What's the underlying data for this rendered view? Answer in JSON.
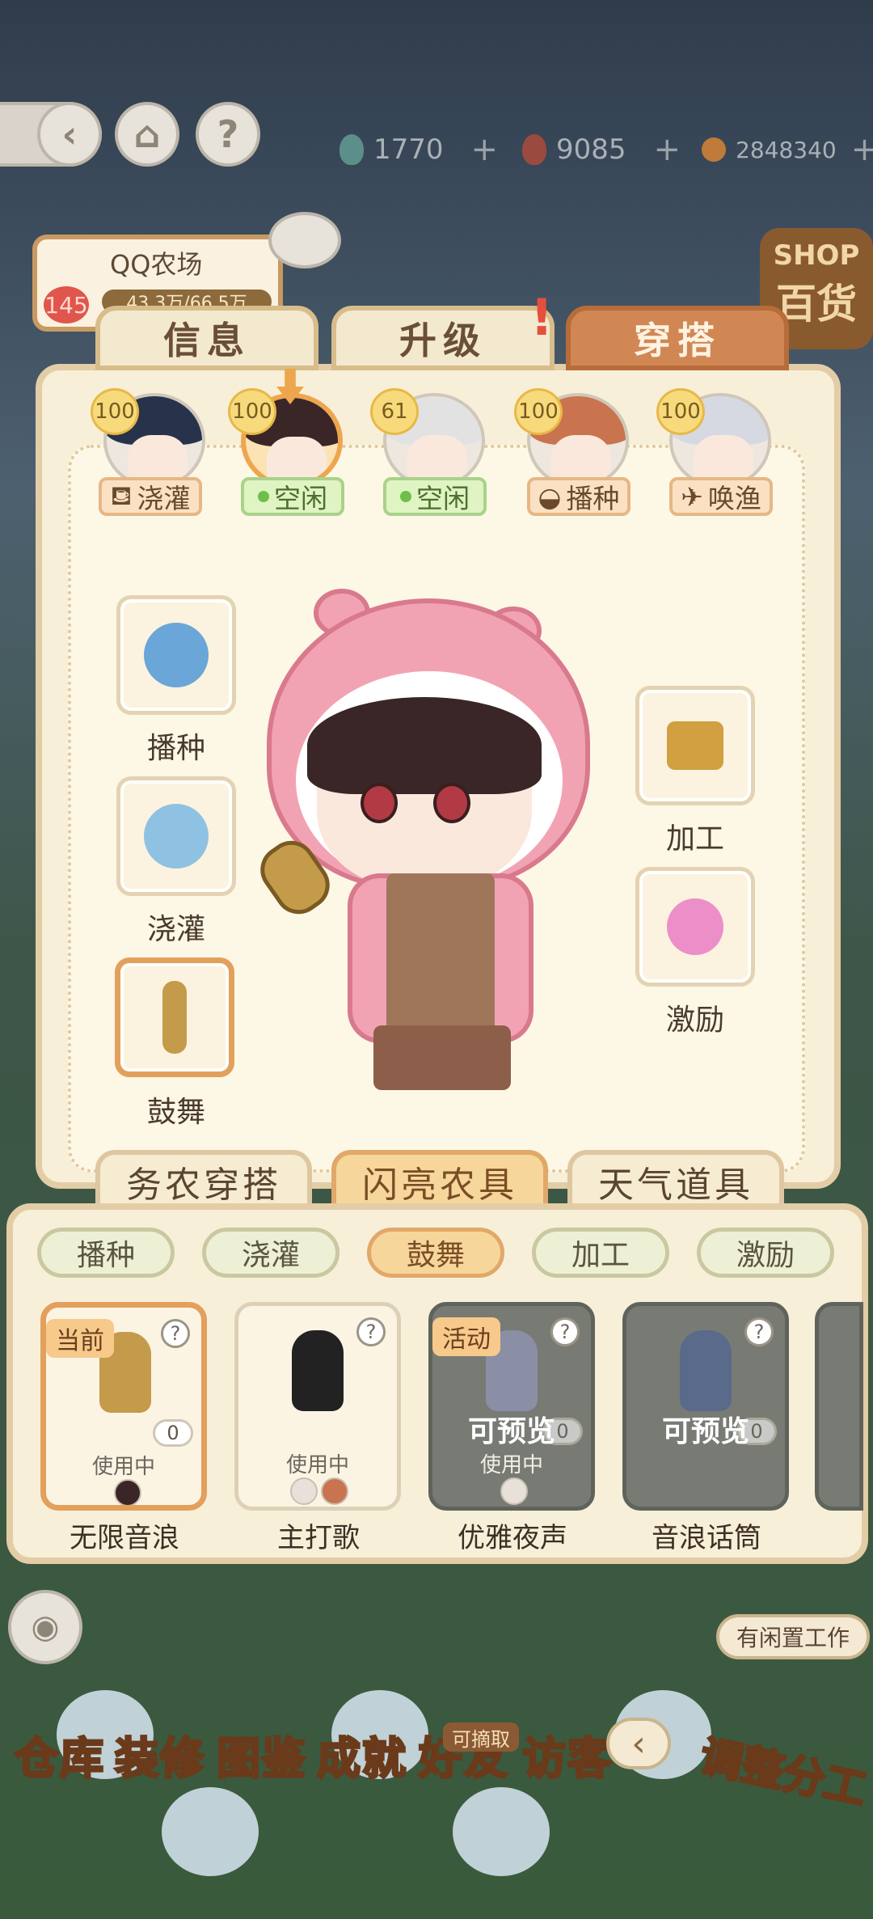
{
  "colors": {
    "accent": "#d18754",
    "panel": "#f8efd9",
    "idle": "#6cc04a",
    "current": "#e2a05c"
  },
  "top_icons": [
    "back-icon",
    "home-icon",
    "help-icon"
  ],
  "resources": [
    {
      "icon": "leaf-icon",
      "value": "1770",
      "plus": "+"
    },
    {
      "icon": "feather-icon",
      "value": "9085",
      "plus": "+"
    },
    {
      "icon": "coin-icon",
      "value": "2848340",
      "plus": "+"
    }
  ],
  "farm": {
    "name": "QQ农场",
    "level": "145",
    "progress": "43.3万/66.5万"
  },
  "shop": {
    "line1": "SHOP",
    "line2": "百货"
  },
  "tabs": [
    "信息",
    "升级",
    "穿搭"
  ],
  "characters": [
    {
      "level": "100",
      "status": "浇灌",
      "hair": "#26334a"
    },
    {
      "level": "100",
      "status": "空闲",
      "hair": "#3a2626"
    },
    {
      "level": "61",
      "status": "空闲",
      "hair": "#e2e2e2"
    },
    {
      "level": "100",
      "status": "播种",
      "hair": "#c9744e"
    },
    {
      "level": "100",
      "status": "唤渔",
      "hair": "#d7d9e2"
    }
  ],
  "slots": {
    "left": [
      "播种",
      "浇灌",
      "鼓舞"
    ],
    "right": [
      "加工",
      "激励"
    ]
  },
  "subtabs": [
    "务农穿搭",
    "闪亮农具",
    "天气道具"
  ],
  "pills": [
    "播种",
    "浇灌",
    "鼓舞",
    "加工",
    "激励"
  ],
  "cards": [
    {
      "name": "无限音浪",
      "tag": "当前",
      "q": "?",
      "count": "0",
      "status": "使用中"
    },
    {
      "name": "主打歌",
      "q": "?",
      "status": "使用中"
    },
    {
      "name": "优雅夜声",
      "tag": "活动",
      "q": "?",
      "count": "0",
      "status": "使用中",
      "preview": "可预览"
    },
    {
      "name": "音浪话筒",
      "q": "?",
      "count": "0",
      "preview": "可预览"
    }
  ],
  "idle_work": "有闲置工作",
  "bottom_nav": [
    "仓库",
    "装修",
    "图鉴",
    "成就",
    "好友",
    "访客"
  ],
  "friend_badge": "可摘取",
  "assign": "调整分工"
}
